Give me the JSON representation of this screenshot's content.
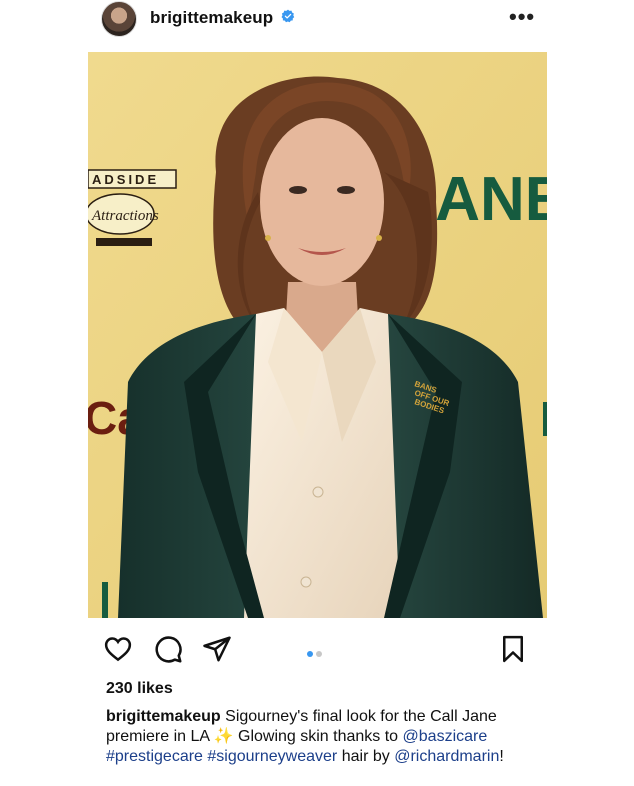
{
  "post": {
    "username": "brigittemakeup",
    "verified": true,
    "more_icon": "more-horizontal-icon",
    "image_text": {
      "logo_top": "ADSIDE",
      "logo_script": "Attractions",
      "big_word": "IANE",
      "side_word": "Call",
      "pin_text": "BANS OFF OUR BODIES"
    },
    "carousel": {
      "count": 2,
      "active_index": 0
    },
    "likes": "230 likes",
    "caption": {
      "user": "brigittemakeup",
      "text_1": "Sigourney's final look for the Call Jane premiere in LA",
      "sparkles": "✨",
      "text_2": "Glowing skin thanks to",
      "tags": [
        "@baszicare",
        "#prestigecare",
        "#sigourneyweaver"
      ],
      "text_3": "hair by",
      "mention": "@richardmarin",
      "end": "!"
    }
  },
  "icons": {
    "like": "heart-icon",
    "comment": "comment-icon",
    "share": "share-icon",
    "save": "bookmark-icon"
  },
  "colors": {
    "link": "#1c3f8a",
    "verified": "#3897f0",
    "dot_active": "#3897f0",
    "dot_inactive": "#c7c7c7",
    "backdrop": "#ecd483",
    "suit": "#1f3a34"
  }
}
